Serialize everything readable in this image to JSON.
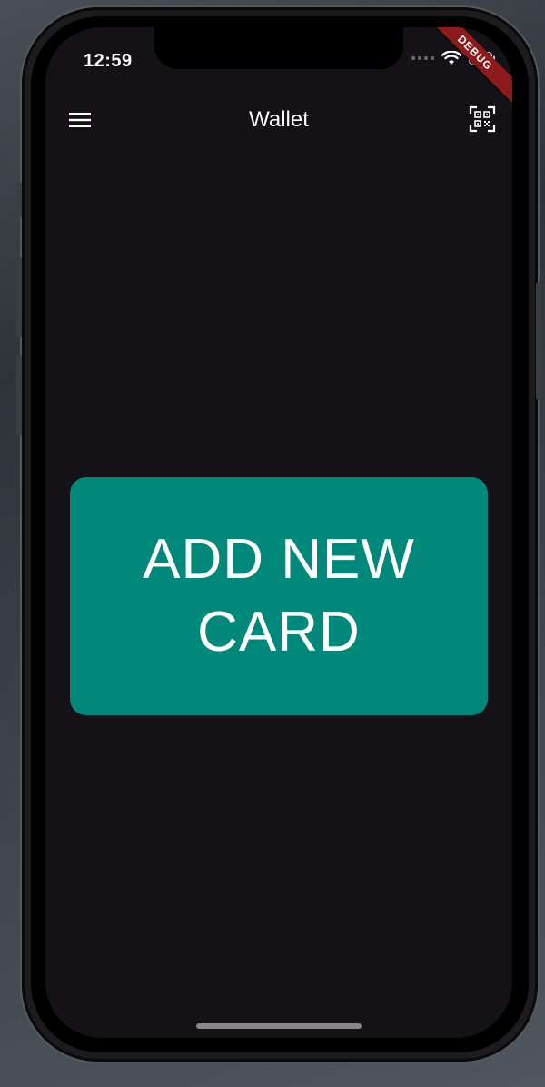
{
  "status_bar": {
    "time": "12:59",
    "debug_label": "DEBUG"
  },
  "app_bar": {
    "title": "Wallet",
    "menu_icon": "hamburger-menu-icon",
    "scan_icon": "qr-scan-icon"
  },
  "main": {
    "add_card_label": "ADD NEW CARD"
  },
  "colors": {
    "background": "#141216",
    "card_button": "#00897b",
    "debug_ribbon": "#8e1b1b"
  }
}
